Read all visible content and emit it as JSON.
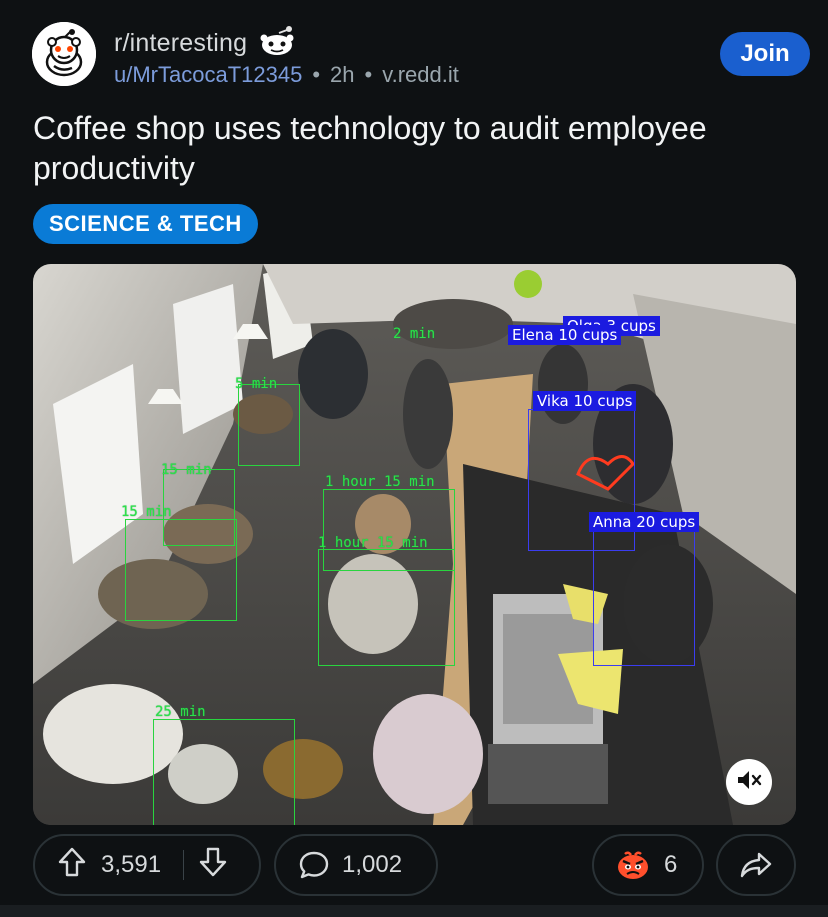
{
  "header": {
    "community": "r/interesting",
    "username": "u/MrTacocaT12345",
    "time": "2h",
    "domain": "v.redd.it",
    "join_label": "Join"
  },
  "post": {
    "title": "Coffee shop uses technology to audit employee productivity",
    "flair": "SCIENCE & TECH"
  },
  "video": {
    "overlay_labels": [
      "2 min",
      "5 min",
      "15 min",
      "15 min",
      "1 hour 15 min",
      "1 hour 15 min",
      "25 min"
    ],
    "cup_labels": [
      "Olga 3 cups",
      "Elena 10 cups",
      "Vika 10 cups",
      "Anna 20 cups"
    ]
  },
  "actions": {
    "upvotes": "3,591",
    "comments": "1,002",
    "awards": "6"
  },
  "colors": {
    "background": "#0e1113",
    "join_button": "#1a5fcf",
    "flair": "#0a7bd6",
    "username": "#7c9cdb",
    "cv_green": "#2ee04a",
    "cv_blue": "#1b1be0"
  },
  "icons": {
    "avatar": "subreddit-avatar-icon",
    "badge": "snoo-badge-icon",
    "mute": "speaker-muted-icon",
    "upvote": "arrow-up-icon",
    "downvote": "arrow-down-icon",
    "comment": "speech-bubble-icon",
    "award": "award-icon",
    "share": "share-icon"
  }
}
